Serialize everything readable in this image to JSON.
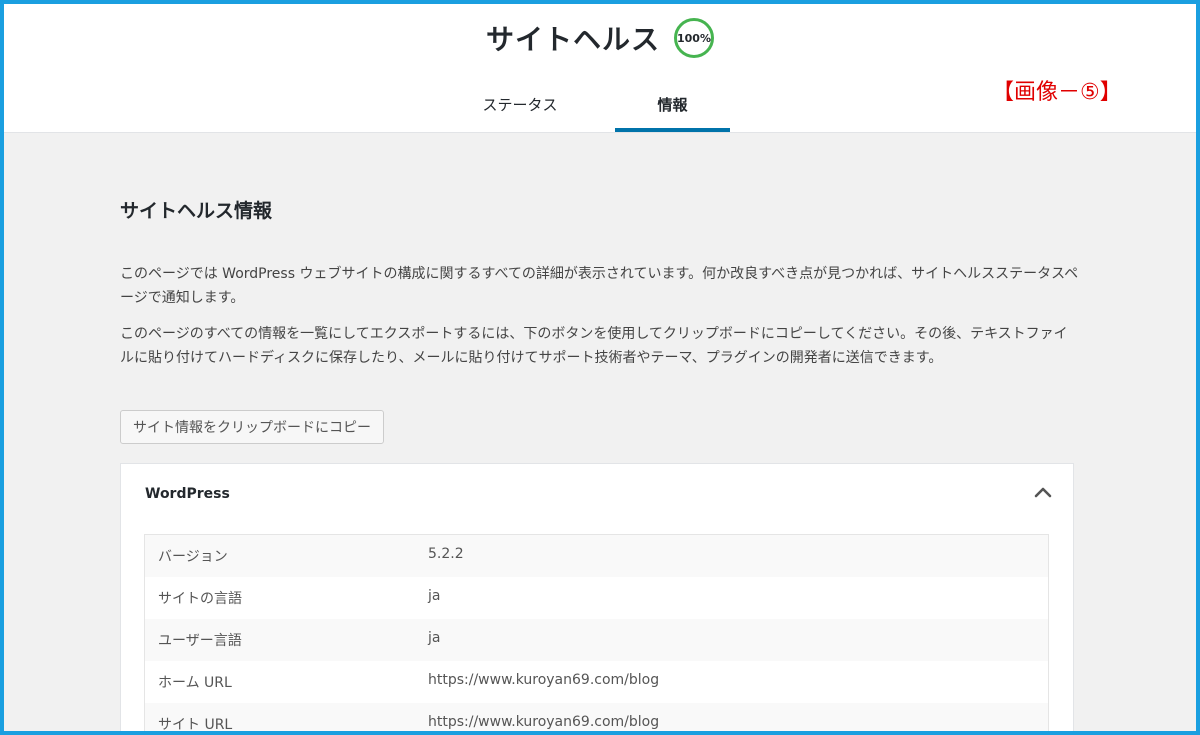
{
  "header": {
    "title": "サイトヘルス",
    "score": "100%",
    "tabs": [
      {
        "label": "ステータス",
        "active": false
      },
      {
        "label": "情報",
        "active": true
      }
    ],
    "annotation": "【画像－⑤】"
  },
  "main": {
    "section_title": "サイトヘルス情報",
    "paragraphs": [
      "このページでは WordPress ウェブサイトの構成に関するすべての詳細が表示されています。何か改良すべき点が見つかれば、サイトヘルスステータスページで通知します。",
      "このページのすべての情報を一覧にしてエクスポートするには、下のボタンを使用してクリップボードにコピーしてください。その後、テキストファイルに貼り付けてハードディスクに保存したり、メールに貼り付けてサポート技術者やテーマ、プラグインの開発者に送信できます。"
    ],
    "copy_button": "サイト情報をクリップボードにコピー",
    "panel": {
      "title": "WordPress",
      "rows": [
        {
          "label": "バージョン",
          "value": "5.2.2"
        },
        {
          "label": "サイトの言語",
          "value": "ja"
        },
        {
          "label": "ユーザー言語",
          "value": "ja"
        },
        {
          "label": "ホーム URL",
          "value": "https://www.kuroyan69.com/blog"
        },
        {
          "label": "サイト URL",
          "value": "https://www.kuroyan69.com/blog"
        }
      ]
    }
  },
  "colors": {
    "accent": "#0073aa",
    "score_ring": "#46b450",
    "annotation": "#e00000",
    "frame_border": "#1a9fe0"
  }
}
